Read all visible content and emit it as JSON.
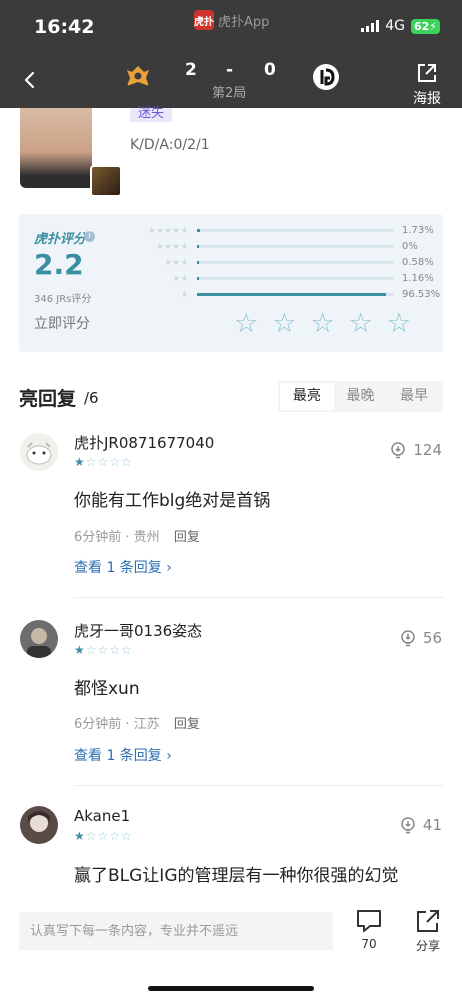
{
  "status_bar": {
    "time": "16:42",
    "app_name": "虎扑App",
    "network": "4G",
    "battery": "62"
  },
  "match": {
    "score_left": "2",
    "score_dash": "-",
    "score_right": "0",
    "game_label": "第2局",
    "poster_label": "海报"
  },
  "player": {
    "tag": "迷失",
    "kda": "K/D/A:0/2/1"
  },
  "rating": {
    "brand": "虎扑评分",
    "score": "2.2",
    "count_text": "346 JRs评分",
    "rate_now": "立即评分",
    "distribution": [
      {
        "stars": 5,
        "pct_text": "1.73%",
        "pct": 1.73
      },
      {
        "stars": 4,
        "pct_text": "0%",
        "pct": 0
      },
      {
        "stars": 3,
        "pct_text": "0.58%",
        "pct": 0.58
      },
      {
        "stars": 2,
        "pct_text": "1.16%",
        "pct": 1.16
      },
      {
        "stars": 1,
        "pct_text": "96.53%",
        "pct": 96.53
      }
    ]
  },
  "replies": {
    "title": "亮回复",
    "count": "/6",
    "sort_tabs": [
      "最亮",
      "最晚",
      "最早"
    ],
    "active_tab": 0,
    "comments": [
      {
        "user": "虎扑JR0871677040",
        "stars": 1,
        "likes": "124",
        "text": "你能有工作blg绝对是首锅",
        "time": "6分钟前",
        "location": "· 贵州",
        "reply_label": "回复",
        "view_replies": "查看 1 条回复"
      },
      {
        "user": "虎牙一哥0136姿态",
        "stars": 1,
        "likes": "56",
        "text": "都怪xun",
        "time": "6分钟前",
        "location": "· 江苏",
        "reply_label": "回复",
        "view_replies": "查看 1 条回复"
      },
      {
        "user": "Akane1",
        "stars": 1,
        "likes": "41",
        "text": "赢了BLG让IG的管理层有一种你很强的幻觉"
      }
    ]
  },
  "bottom_bar": {
    "input_placeholder": "认真写下每一条内容，专业并不遥远",
    "comment_count": "70",
    "share_label": "分享"
  },
  "colors": {
    "header_bg": "#3b3b3b",
    "accent": "#3b8fa2",
    "card_bg": "#eef4f8",
    "link": "#2d6fb3",
    "battery": "#3bd15a"
  }
}
